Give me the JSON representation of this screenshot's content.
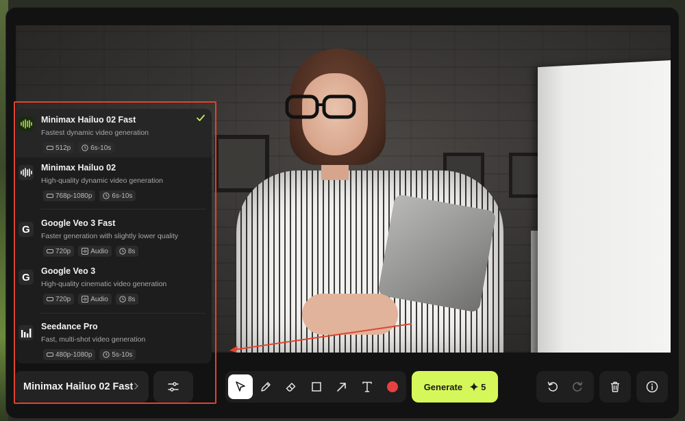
{
  "models": [
    {
      "name": "Minimax Hailuo 02 Fast",
      "description": "Fastest dynamic video generation",
      "icon": "waveform-icon",
      "icon_color": "#b9e44a",
      "selected": true,
      "tags": [
        {
          "icon": "resolution-icon",
          "label": "512p"
        },
        {
          "icon": "clock-icon",
          "label": "6s-10s"
        }
      ]
    },
    {
      "name": "Minimax Hailuo 02",
      "description": "High-quality dynamic video generation",
      "icon": "waveform-icon",
      "icon_color": "#ffffff",
      "selected": false,
      "tags": [
        {
          "icon": "resolution-icon",
          "label": "768p-1080p"
        },
        {
          "icon": "clock-icon",
          "label": "6s-10s"
        }
      ]
    },
    {
      "name": "Google Veo 3 Fast",
      "description": "Faster generation with slightly lower quality",
      "icon": "google-g-icon",
      "icon_glyph": "G",
      "selected": false,
      "tags": [
        {
          "icon": "resolution-icon",
          "label": "720p"
        },
        {
          "icon": "audio-icon",
          "label": "Audio"
        },
        {
          "icon": "clock-icon",
          "label": "8s"
        }
      ]
    },
    {
      "name": "Google Veo 3",
      "description": "High-quality cinematic video generation",
      "icon": "google-g-icon",
      "icon_glyph": "G",
      "selected": false,
      "tags": [
        {
          "icon": "resolution-icon",
          "label": "720p"
        },
        {
          "icon": "audio-icon",
          "label": "Audio"
        },
        {
          "icon": "clock-icon",
          "label": "8s"
        }
      ]
    },
    {
      "name": "Seedance Pro",
      "description": "Fast, multi-shot video generation",
      "icon": "bars-logo-icon",
      "selected": false,
      "tags": [
        {
          "icon": "resolution-icon",
          "label": "480p-1080p"
        },
        {
          "icon": "clock-icon",
          "label": "5s-10s"
        }
      ]
    }
  ],
  "toolbar": {
    "model_select_label": "Minimax Hailuo 02 Fast",
    "settings_icon": "sliders-icon",
    "tools": [
      "select-arrow-icon",
      "pencil-icon",
      "eraser-icon",
      "rectangle-icon",
      "arrow-icon",
      "text-icon",
      "color-dot-icon"
    ],
    "active_tool": "select-arrow-icon",
    "color": "#e84040",
    "generate_label": "Generate",
    "generate_credits": "5",
    "generate_color": "#d6f75a"
  },
  "colors": {
    "accent": "#d6f75a",
    "highlight": "#e0452f"
  }
}
